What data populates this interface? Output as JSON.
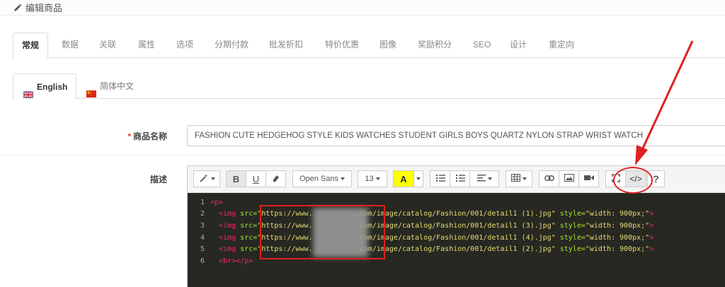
{
  "header": {
    "title": "编辑商品",
    "icon": "pencil-icon"
  },
  "tabs": [
    {
      "label": "常规",
      "active": true
    },
    {
      "label": "数据"
    },
    {
      "label": "关联"
    },
    {
      "label": "属性"
    },
    {
      "label": "选项"
    },
    {
      "label": "分期付款"
    },
    {
      "label": "批发折扣"
    },
    {
      "label": "特价优惠"
    },
    {
      "label": "图像"
    },
    {
      "label": "奖励积分"
    },
    {
      "label": "SEO"
    },
    {
      "label": "设计"
    },
    {
      "label": "重定向"
    }
  ],
  "language_tabs": [
    {
      "label": "English",
      "icon": "uk-flag-icon",
      "active": true
    },
    {
      "label": "简体中文",
      "icon": "china-flag-icon"
    }
  ],
  "form": {
    "name_label": "商品名称",
    "name_value": "FASHION CUTE HEDGEHOG STYLE KIDS WATCHES STUDENT GIRLS BOYS QUARTZ NYLON STRAP WRIST WATCH",
    "description_label": "描述"
  },
  "editor": {
    "toolbar": {
      "font_family": "Open Sans",
      "font_size": "13",
      "help": "?",
      "bold": "B",
      "underline": "U",
      "color_letter": "A",
      "code_view": "</>"
    },
    "code_lines": [
      {
        "n": "1",
        "parts": [
          [
            "tag",
            "<p>"
          ]
        ]
      },
      {
        "n": "2",
        "parts": [
          [
            "tag",
            "<img "
          ],
          [
            "attr",
            "src="
          ],
          [
            "str",
            "\"https://www."
          ],
          [
            "plain",
            "          "
          ],
          [
            "str",
            ".com/image/catalog/Fashion/001/detail1 (1).jpg\""
          ],
          [
            "plain",
            " "
          ],
          [
            "attr",
            "style="
          ],
          [
            "str",
            "\"width: 900px;\""
          ],
          [
            "tag",
            ">"
          ]
        ]
      },
      {
        "n": "3",
        "parts": [
          [
            "tag",
            "<img "
          ],
          [
            "attr",
            "src="
          ],
          [
            "str",
            "\"https://www."
          ],
          [
            "plain",
            "          "
          ],
          [
            "str",
            ".com/image/catalog/Fashion/001/detail1 (3).jpg\""
          ],
          [
            "plain",
            " "
          ],
          [
            "attr",
            "style="
          ],
          [
            "str",
            "\"width: 900px;\""
          ],
          [
            "tag",
            ">"
          ]
        ]
      },
      {
        "n": "4",
        "parts": [
          [
            "tag",
            "<img "
          ],
          [
            "attr",
            "src="
          ],
          [
            "str",
            "\"https://www."
          ],
          [
            "plain",
            "          "
          ],
          [
            "str",
            ".com/image/catalog/Fashion/001/detail1 (4).jpg\""
          ],
          [
            "plain",
            " "
          ],
          [
            "attr",
            "style="
          ],
          [
            "str",
            "\"width: 900px;\""
          ],
          [
            "tag",
            ">"
          ]
        ]
      },
      {
        "n": "5",
        "parts": [
          [
            "tag",
            "<img "
          ],
          [
            "attr",
            "src="
          ],
          [
            "str",
            "\"https://www."
          ],
          [
            "plain",
            "          "
          ],
          [
            "str",
            ".com/image/catalog/Fashion/001/detail1 (2).jpg\""
          ],
          [
            "plain",
            " "
          ],
          [
            "attr",
            "style="
          ],
          [
            "str",
            "\"width: 900px;\""
          ],
          [
            "tag",
            ">"
          ]
        ]
      },
      {
        "n": "6",
        "parts": [
          [
            "tag",
            "<br></p>"
          ]
        ]
      }
    ]
  },
  "colors": {
    "accent_red": "#e02020",
    "code_bg": "#272822",
    "tag": "#f92672",
    "attr": "#a6e22e",
    "string": "#e6db74"
  }
}
